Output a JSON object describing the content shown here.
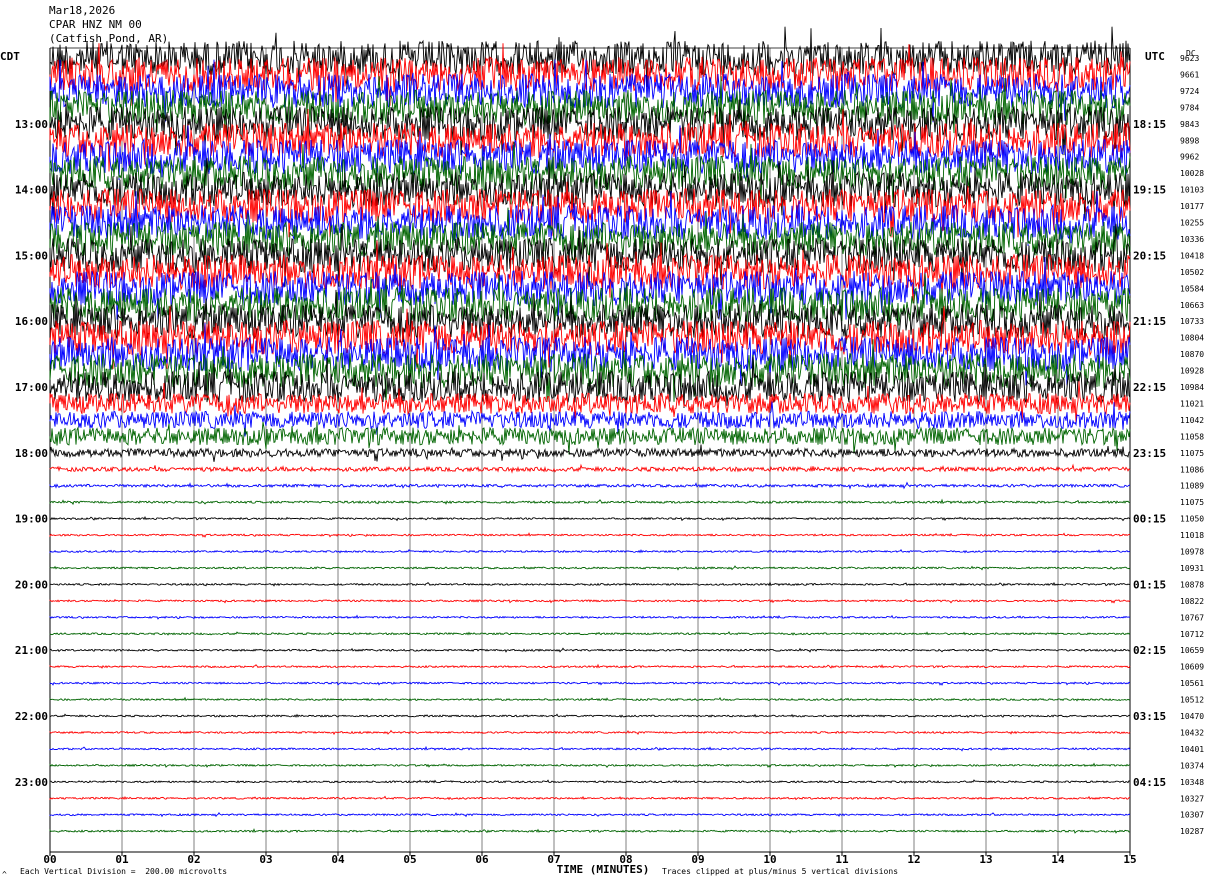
{
  "header": {
    "date": "Mar18,2026",
    "station": "CPAR HNZ NM 00",
    "location": "(Catfish Pond, AR)"
  },
  "left_timezone": "CDT",
  "right_timezone": "UTC",
  "dc_label": "DC",
  "footer": {
    "scale_note": "Each Vertical Division =  200.00 microvolts",
    "clip_note": "Traces clipped at plus/minus 5 vertical divisions",
    "corner_mark": "^"
  },
  "colors": {
    "trace_cycle": [
      "#000000",
      "#ff0000",
      "#0000ff",
      "#006400"
    ],
    "grid": "#000000"
  },
  "chart_data": {
    "type": "line",
    "title": "CPAR HNZ NM 00 (Catfish Pond, AR) Mar18,2026",
    "xlabel": "TIME (MINUTES)",
    "x_ticks": [
      "00",
      "01",
      "02",
      "03",
      "04",
      "05",
      "06",
      "07",
      "08",
      "09",
      "10",
      "11",
      "12",
      "13",
      "14",
      "15"
    ],
    "xlim": [
      0,
      15
    ],
    "rows_per_hour": 4,
    "left_hour_labels": [
      "13:00",
      "14:00",
      "15:00",
      "16:00",
      "17:00",
      "18:00",
      "19:00",
      "20:00",
      "21:00",
      "22:00",
      "23:00"
    ],
    "right_hour_labels": [
      "18:15",
      "19:15",
      "20:15",
      "21:15",
      "22:15",
      "23:15",
      "00:15",
      "01:15",
      "02:15",
      "03:15",
      "04:15"
    ],
    "dc_offsets": [
      9623,
      9661,
      9724,
      9784,
      9843,
      9898,
      9962,
      10028,
      10103,
      10177,
      10255,
      10336,
      10418,
      10502,
      10584,
      10663,
      10733,
      10804,
      10870,
      10928,
      10984,
      11021,
      11042,
      11058,
      11075,
      11086,
      11089,
      11075,
      11050,
      11018,
      10978,
      10931,
      10878,
      10822,
      10767,
      10712,
      10659,
      10609,
      10561,
      10512,
      10470,
      10432,
      10401,
      10374,
      10348,
      10327,
      10307,
      10287
    ],
    "noise_amplitude": [
      5,
      5,
      5,
      5,
      5,
      5,
      5,
      5,
      5,
      5,
      5,
      5,
      5,
      5,
      5,
      5,
      5,
      5,
      5,
      5,
      4.5,
      3,
      2.5,
      2.5,
      1.2,
      0.6,
      0.4,
      0.3,
      0.25,
      0.25,
      0.25,
      0.25,
      0.25,
      0.25,
      0.25,
      0.25,
      0.25,
      0.25,
      0.25,
      0.25,
      0.25,
      0.25,
      0.25,
      0.25,
      0.25,
      0.25,
      0.25,
      0.25
    ],
    "clip_divisions": 5,
    "scale_microvolts_per_division": 200
  }
}
